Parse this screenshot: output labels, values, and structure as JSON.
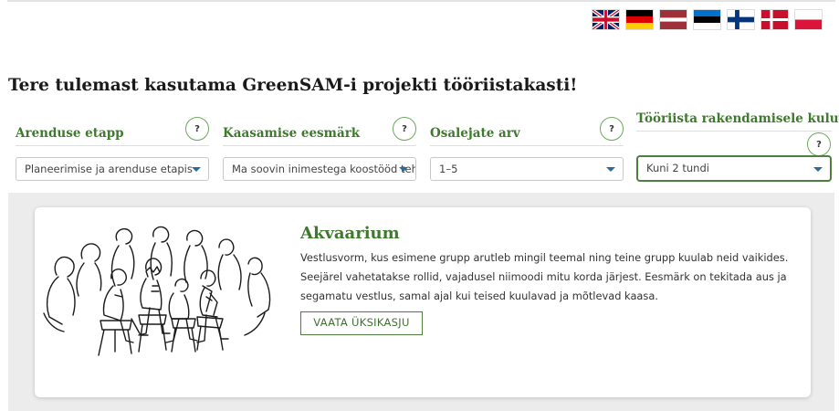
{
  "languages": [
    {
      "code": "en",
      "icon": "uk-flag-icon"
    },
    {
      "code": "de",
      "icon": "germany-flag-icon"
    },
    {
      "code": "lv",
      "icon": "latvia-flag-icon"
    },
    {
      "code": "et",
      "icon": "estonia-flag-icon"
    },
    {
      "code": "fi",
      "icon": "finland-flag-icon"
    },
    {
      "code": "da",
      "icon": "denmark-flag-icon"
    },
    {
      "code": "pl",
      "icon": "poland-flag-icon"
    }
  ],
  "page_title": "Tere tulemast kasutama GreenSAM-i projekti tööriistakasti!",
  "filters": {
    "stage": {
      "label": "Arenduse etapp",
      "help": "?",
      "selected": "Planeerimise ja arenduse etapis"
    },
    "goal": {
      "label": "Kaasamise eesmärk",
      "help": "?",
      "selected": "Ma soovin inimestega koostööd teha"
    },
    "participants": {
      "label": "Osalejate arv",
      "help": "?",
      "selected": "1–5"
    },
    "time": {
      "label": "Tööriista rakendamisele kuluv aeg",
      "help": "?",
      "selected": "Kuni 2 tundi"
    }
  },
  "card": {
    "title": "Akvaarium",
    "description": "Vestlusvorm, kus esimene grupp arutleb mingil teemal ning teine grupp kuulab neid vaikides. Seejärel vahetatakse rollid, vajadusel niimoodi mitu korda järjest. Eesmärk on tekitada aus ja segamatu vestlus, samal ajal kui teised kuulavad ja mõtlevad kaasa.",
    "button_label": "VAATA ÜKSIKASJU",
    "image_icon": "fishbowl-discussion-illustration"
  },
  "colors": {
    "accent_green": "#3e7a2b",
    "border_green": "#4f7f3e",
    "card_background": "#ececec",
    "caret_blue": "#2a6b9b"
  }
}
